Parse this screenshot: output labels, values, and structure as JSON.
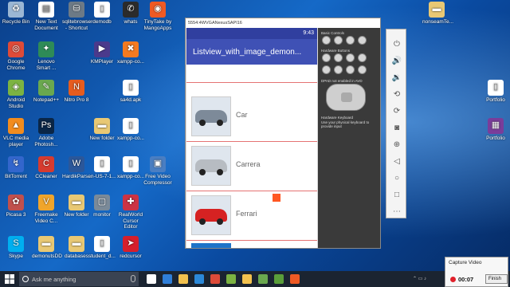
{
  "desktop": {
    "icons": [
      {
        "label": "Recycle Bin",
        "icon": "recycle-bin-icon",
        "color": "#9bb7d4"
      },
      {
        "label": "New Text Document",
        "icon": "text-document-icon",
        "color": "#ffffff"
      },
      {
        "label": "sqlitebrowser - Shortcut",
        "icon": "sqlitebrowser-icon",
        "color": "#6d7a86"
      },
      {
        "label": "demodb",
        "icon": "file-icon",
        "color": "#ffffff"
      },
      {
        "label": "whats",
        "icon": "whatsapp-icon",
        "color": "#2b2b2b"
      },
      {
        "label": "TinyTake by MangoApps",
        "icon": "tinytake-icon",
        "color": "#ef5a24"
      },
      {
        "label": "Google Chrome",
        "icon": "chrome-icon",
        "color": "#dd4b39"
      },
      {
        "label": "Lenovo Smart ...",
        "icon": "lenovo-icon",
        "color": "#2e8b57"
      },
      {
        "label": "KMPlayer",
        "icon": "kmplayer-icon",
        "color": "#4b3a8c"
      },
      {
        "label": "xampp-co...",
        "icon": "xampp-icon",
        "color": "#f47a20"
      },
      {
        "label": "Android Studio",
        "icon": "android-studio-icon",
        "color": "#7cb342"
      },
      {
        "label": "Notepad++",
        "icon": "notepad-plus-icon",
        "color": "#6aa84f"
      },
      {
        "label": "Nitro Pro 8",
        "icon": "nitro-icon",
        "color": "#e65c1f"
      },
      {
        "label": "sa4d.apk",
        "icon": "file-icon",
        "color": "#ffffff"
      },
      {
        "label": "VLC media player",
        "icon": "vlc-icon",
        "color": "#f28c1e"
      },
      {
        "label": "Adobe Photosh...",
        "icon": "photoshop-icon",
        "color": "#0a2647"
      },
      {
        "label": "New folder",
        "icon": "folder-icon",
        "color": "#e8c874"
      },
      {
        "label": "xampp-co...",
        "icon": "file-icon",
        "color": "#ffffff"
      },
      {
        "label": "BitTorrent",
        "icon": "bittorrent-icon",
        "color": "#3366cc"
      },
      {
        "label": "CCleaner",
        "icon": "ccleaner-icon",
        "color": "#d63b2f"
      },
      {
        "label": "HardikPars...",
        "icon": "word-document-icon",
        "color": "#2b579a"
      },
      {
        "label": "en-US-7-1...",
        "icon": "file-icon",
        "color": "#ffffff"
      },
      {
        "label": "xampp-co...",
        "icon": "file-icon",
        "color": "#ffffff"
      },
      {
        "label": "Free Video Compressor",
        "icon": "video-compressor-icon",
        "color": "#4a7ec2"
      },
      {
        "label": "Picasa 3",
        "icon": "picasa-icon",
        "color": "#c0504d"
      },
      {
        "label": "Freemake Video C...",
        "icon": "freemake-icon",
        "color": "#f0a52b"
      },
      {
        "label": "New folder",
        "icon": "folder-icon",
        "color": "#e8c874"
      },
      {
        "label": "monitor",
        "icon": "monitor-icon",
        "color": "#7a8a99"
      },
      {
        "label": "RealWorld Cursor Editor",
        "icon": "cursor-editor-icon",
        "color": "#cc3344"
      },
      {
        "label": "Skype",
        "icon": "skype-icon",
        "color": "#00aff0"
      },
      {
        "label": "demonutsDD",
        "icon": "folder-icon",
        "color": "#e8c874"
      },
      {
        "label": "databases",
        "icon": "folder-icon",
        "color": "#e8c874"
      },
      {
        "label": "student_d...",
        "icon": "file-icon",
        "color": "#ffffff"
      },
      {
        "label": "redcursor",
        "icon": "cursor-icon",
        "color": "#d61f2c"
      },
      {
        "label": "nonseamTe...",
        "icon": "folder-icon",
        "color": "#e8c874"
      },
      {
        "label": "Portfolio",
        "icon": "file-icon",
        "color": "#ffffff"
      },
      {
        "label": "Portfolio",
        "icon": "rar-archive-icon",
        "color": "#7a3d9a"
      }
    ]
  },
  "emulator": {
    "window_title": "5554:4WVGANexusSAPI16",
    "status_time": "9:43",
    "app_title": "Listview_with_image_demon...",
    "rows": [
      {
        "label": "Car",
        "car_color": "#7d8a99"
      },
      {
        "label": "Carrera",
        "car_color": "#b7bcc2"
      },
      {
        "label": "Ferrari",
        "car_color": "#d62222"
      }
    ],
    "controls": {
      "basic_controls": "Basic Controls",
      "hardware_buttons": "Hardware Buttons",
      "dpad_label": "DPAD not enabled in AVD",
      "keyboard_label": "Hardware Keyboard",
      "keyboard_hint": "Use your physical keyboard to provide input"
    }
  },
  "side_toolbar": {
    "buttons": [
      "power-icon",
      "volume-up-icon",
      "volume-down-icon",
      "rotate-left-icon",
      "rotate-right-icon",
      "camera-icon",
      "zoom-in-icon",
      "back-icon",
      "home-icon",
      "overview-icon",
      "more-icon"
    ]
  },
  "taskbar": {
    "search_placeholder": "Ask me anything",
    "apps": [
      {
        "icon": "task-view-icon",
        "color": "#ffffff"
      },
      {
        "icon": "edge-icon",
        "color": "#2f7ed8"
      },
      {
        "icon": "file-explorer-icon",
        "color": "#f2c14e"
      },
      {
        "icon": "store-icon",
        "color": "#2b88d8"
      },
      {
        "icon": "chrome-icon",
        "color": "#dd4b39"
      },
      {
        "icon": "android-studio-icon",
        "color": "#7cb342"
      },
      {
        "icon": "file-explorer-icon",
        "color": "#f2c14e"
      },
      {
        "icon": "notepad-plus-icon",
        "color": "#6aa84f"
      },
      {
        "icon": "emulator-icon",
        "color": "#5a9e3a"
      },
      {
        "icon": "tinytake-icon",
        "color": "#ef5a24"
      }
    ]
  },
  "capture": {
    "title": "Capture Video",
    "time": "00:07",
    "finish_label": "Finish"
  }
}
